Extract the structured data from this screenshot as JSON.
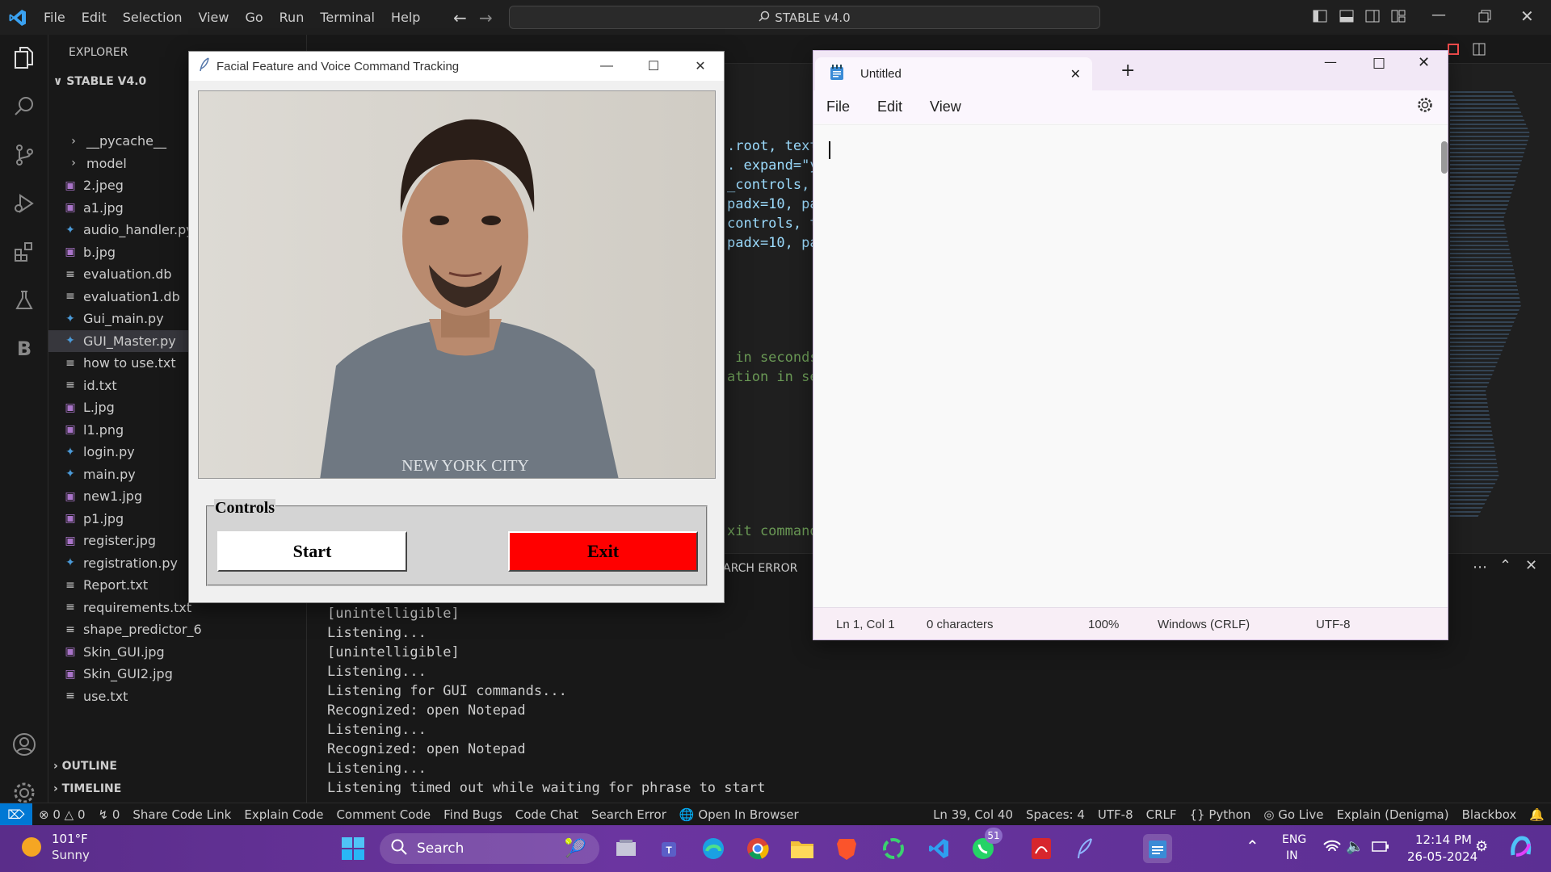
{
  "vscode": {
    "menu": [
      "File",
      "Edit",
      "Selection",
      "View",
      "Go",
      "Run",
      "Terminal",
      "Help"
    ],
    "command_center": "STABLE v4.0",
    "explorer_title": "EXPLORER",
    "project": "STABLE V4.0",
    "files": [
      {
        "name": "__pycache__",
        "type": "folder"
      },
      {
        "name": "model",
        "type": "folder"
      },
      {
        "name": "2.jpeg",
        "type": "image"
      },
      {
        "name": "a1.jpg",
        "type": "image"
      },
      {
        "name": "audio_handler.py",
        "type": "python"
      },
      {
        "name": "b.jpg",
        "type": "image"
      },
      {
        "name": "evaluation.db",
        "type": "text"
      },
      {
        "name": "evaluation1.db",
        "type": "text"
      },
      {
        "name": "Gui_main.py",
        "type": "python"
      },
      {
        "name": "GUI_Master.py",
        "type": "python"
      },
      {
        "name": "how to use.txt",
        "type": "text"
      },
      {
        "name": "id.txt",
        "type": "text"
      },
      {
        "name": "L.jpg",
        "type": "image"
      },
      {
        "name": "l1.png",
        "type": "image"
      },
      {
        "name": "login.py",
        "type": "python"
      },
      {
        "name": "main.py",
        "type": "python"
      },
      {
        "name": "new1.jpg",
        "type": "image"
      },
      {
        "name": "p1.jpg",
        "type": "image"
      },
      {
        "name": "register.jpg",
        "type": "image"
      },
      {
        "name": "registration.py",
        "type": "python"
      },
      {
        "name": "Report.txt",
        "type": "text"
      },
      {
        "name": "requirements.txt",
        "type": "text"
      },
      {
        "name": "shape_predictor_6",
        "type": "text"
      },
      {
        "name": "Skin_GUI.jpg",
        "type": "image"
      },
      {
        "name": "Skin_GUI2.jpg",
        "type": "image"
      },
      {
        "name": "use.txt",
        "type": "text"
      }
    ],
    "selected_file": "GUI_Master.py",
    "outline": "OUTLINE",
    "timeline": "TIMELINE",
    "code_fragments": [
      ".root, text",
      ". expand=\"ye",
      "_controls, ",
      "padx=10, pa",
      "controls, t",
      "padx=10, pa",
      " in seconds",
      "ation in se",
      "xit command"
    ],
    "terminal_tab": "ARCH ERROR",
    "terminal_lines": [
      "[unintelligible]",
      "Listening...",
      "[unintelligible]",
      "Listening...",
      "Listening for GUI commands...",
      "Recognized: open Notepad",
      "Listening...",
      "Recognized: open Notepad",
      "Listening...",
      "Listening timed out while waiting for phrase to start"
    ],
    "status": {
      "errors": "0",
      "warnings": "0",
      "ports": "0",
      "items": [
        "Share Code Link",
        "Explain Code",
        "Comment Code",
        "Find Bugs",
        "Code Chat",
        "Search Error"
      ],
      "browser": "Open In Browser",
      "position": "Ln 39, Col 40",
      "spaces": "Spaces: 4",
      "encoding": "UTF-8",
      "eol": "CRLF",
      "language": "Python",
      "golive": "Go Live",
      "explain": "Explain (Denigma)",
      "blackbox": "Blackbox"
    }
  },
  "tk_window": {
    "title": "Facial Feature and Voice Command Tracking",
    "controls_label": "Controls",
    "start": "Start",
    "exit": "Exit",
    "exit_color": "#ff0000",
    "shirt_text": "NEW YORK CITY"
  },
  "notepad": {
    "tab_title": "Untitled",
    "menu": [
      "File",
      "Edit",
      "View"
    ],
    "status": {
      "pos": "Ln 1, Col 1",
      "chars": "0 characters",
      "zoom": "100%",
      "eol": "Windows (CRLF)",
      "enc": "UTF-8"
    }
  },
  "taskbar": {
    "weather_temp": "101°F",
    "weather_desc": "Sunny",
    "search": "Search",
    "whatsapp_badge": "51",
    "lang1": "ENG",
    "lang2": "IN",
    "time": "12:14 PM",
    "date": "26-05-2024"
  }
}
